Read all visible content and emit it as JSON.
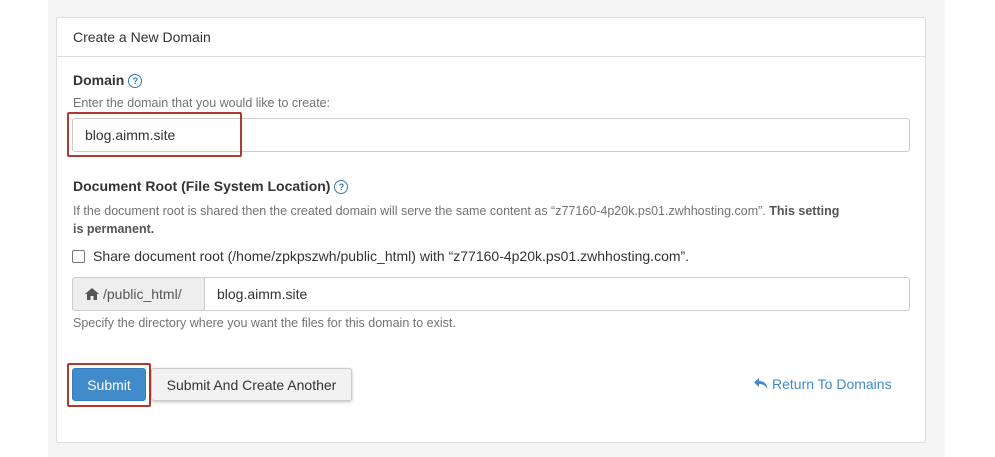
{
  "panel": {
    "title": "Create a New Domain"
  },
  "domain": {
    "label": "Domain",
    "hint": "Enter the domain that you would like to create:",
    "value": "blog.aimm.site"
  },
  "docroot": {
    "label": "Document Root (File System Location)",
    "hint_text": "If the document root is shared then the created domain will serve the same content as “z77160-4p20k.ps01.zwhhosting.com”.",
    "hint_bold_1": "This setting",
    "hint_bold_2": "is permanent.",
    "share_label": "Share document root (/home/zpkpszwh/public_html) with “z77160-4p20k.ps01.zwhhosting.com”.",
    "prefix": "/public_html/",
    "value": "blog.aimm.site",
    "help": "Specify the directory where you want the files for this domain to exist."
  },
  "actions": {
    "submit": "Submit",
    "submit_another": "Submit And Create Another",
    "return": "Return To Domains"
  },
  "colors": {
    "primary": "#428bca",
    "highlight": "#b03a2e"
  },
  "icons": {
    "help": "question-circle-icon",
    "home": "home-icon",
    "return": "reply-arrow-icon"
  }
}
